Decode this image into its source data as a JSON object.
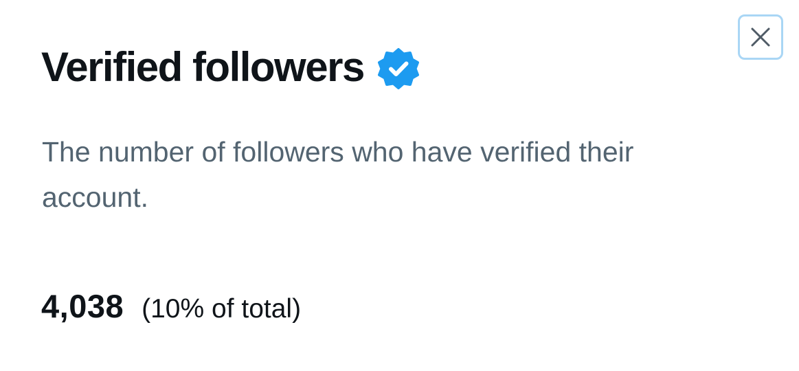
{
  "dialog": {
    "title": "Verified followers",
    "description": "The number of followers who have verified their account.",
    "stat": {
      "value": "4,038",
      "percent_label": "(10% of total)"
    },
    "close_icon": "close-icon",
    "badge_icon": "verified-badge-icon"
  },
  "colors": {
    "title": "#0f1419",
    "description": "#536471",
    "badge": "#1d9bf0",
    "close_border": "#a9d6f5",
    "background": "#ffffff"
  }
}
